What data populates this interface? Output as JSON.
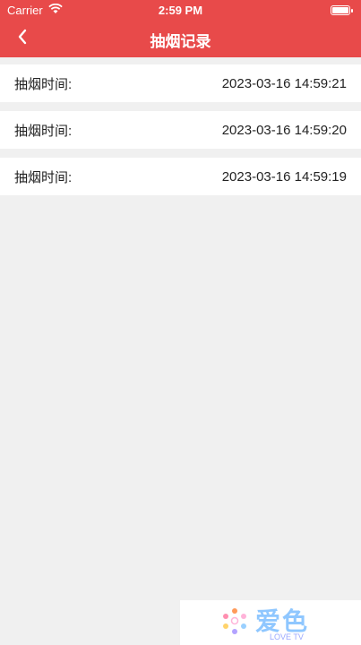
{
  "status": {
    "carrier": "Carrier",
    "time": "2:59 PM"
  },
  "nav": {
    "title": "抽烟记录",
    "back_icon": "chevron-left-icon"
  },
  "records": [
    {
      "label": "抽烟时间:",
      "time": "2023-03-16 14:59:21"
    },
    {
      "label": "抽烟时间:",
      "time": "2023-03-16 14:59:20"
    },
    {
      "label": "抽烟时间:",
      "time": "2023-03-16 14:59:19"
    }
  ],
  "watermark": {
    "main": "爱色",
    "sub": "LOVE TV"
  },
  "colors": {
    "header": "#e84a4a",
    "background": "#f0f0f0",
    "row": "#ffffff"
  }
}
